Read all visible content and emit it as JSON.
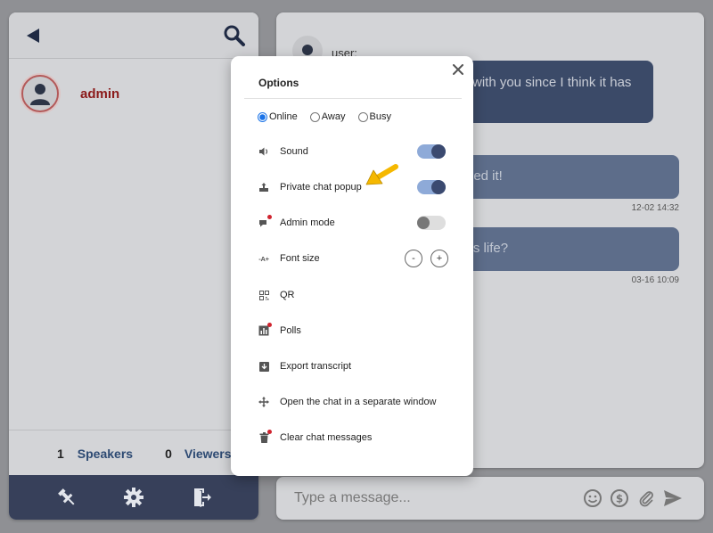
{
  "left": {
    "user": {
      "name": "admin"
    },
    "counts": {
      "speakers_count": "1",
      "speakers_label": "Speakers",
      "viewers_count": "0",
      "viewers_label": "Viewers"
    }
  },
  "chat": {
    "sender": "user:",
    "messages": [
      {
        "text": "with you since I think it has",
        "time": ""
      },
      {
        "text": "led it!",
        "time": "12-02 14:32"
      },
      {
        "text": "'s life?",
        "time": "03-16 10:09"
      }
    ],
    "input_placeholder": "Type a message..."
  },
  "options": {
    "title": "Options",
    "status": {
      "online": "Online",
      "away": "Away",
      "busy": "Busy",
      "selected": "Online"
    },
    "items": [
      {
        "label": "Sound",
        "icon": "speaker-icon",
        "toggle": true
      },
      {
        "label": "Private chat popup",
        "icon": "popup-icon",
        "toggle": true
      },
      {
        "label": "Admin mode",
        "icon": "admin-icon",
        "toggle": false
      },
      {
        "label": "Font size",
        "icon": "font-size-icon",
        "minus": "-",
        "plus": "+"
      },
      {
        "label": "QR",
        "icon": "qr-icon"
      },
      {
        "label": "Polls",
        "icon": "polls-icon"
      },
      {
        "label": "Export transcript",
        "icon": "export-icon"
      },
      {
        "label": "Open the chat in a separate window",
        "icon": "move-icon"
      },
      {
        "label": "Clear chat messages",
        "icon": "trash-icon"
      }
    ],
    "font_icon_text": "-A+"
  },
  "colors": {
    "accent": "#3b4a70",
    "toggle_on": "#8eaad8",
    "admin_name": "#8b1a1a",
    "link": "#2d4a73",
    "footer": "#37405a",
    "annotation_arrow": "#f5b800"
  }
}
